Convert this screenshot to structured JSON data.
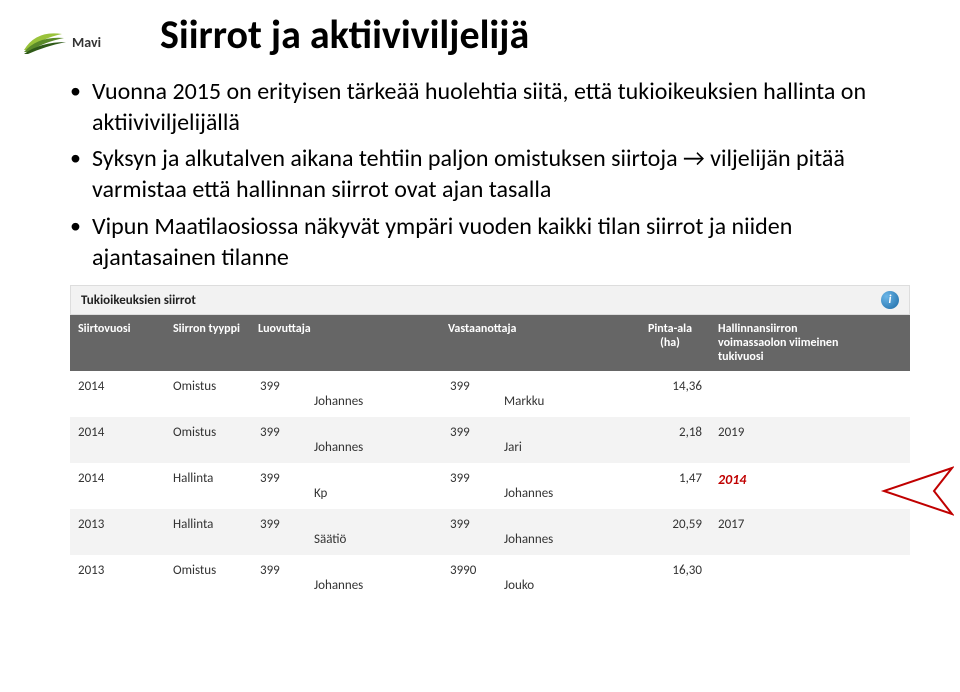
{
  "logo": {
    "text": "Mavi"
  },
  "title": "Siirrot ja aktiiviviljelijä",
  "bullets": [
    "Vuonna 2015 on erityisen tärkeää huolehtia siitä, että tukioikeuksien hallinta on aktiiviviljelijällä",
    "Syksyn ja alkutalven aikana tehtiin paljon omistuksen siirtoja → viljelijän pitää varmistaa että hallinnan siirrot ovat ajan tasalla",
    "Vipun Maatilaosiossa näkyvät ympäri vuoden kaikki tilan siirrot ja niiden ajantasainen tilanne"
  ],
  "panelTitle": "Tukioikeuksien siirrot",
  "headers": {
    "c1": "Siirtovuosi",
    "c2": "Siirron tyyppi",
    "c3": "Luovuttaja",
    "c4": "Vastaanottaja",
    "c5": "Pinta-ala (ha)",
    "c6": "Hallinnansiirron voimassaolon viimeinen tukivuosi"
  },
  "rows": [
    {
      "y": "2014",
      "t": "Omistus",
      "lnum": "399",
      "lname": "Johannes",
      "rnum": "399",
      "rname": "Markku",
      "area": "14,36",
      "end": ""
    },
    {
      "y": "2014",
      "t": "Omistus",
      "lnum": "399",
      "lname": "Johannes",
      "rnum": "399",
      "rname": "Jari",
      "area": "2,18",
      "end": "2019"
    },
    {
      "y": "2014",
      "t": "Hallinta",
      "lnum": "399",
      "lname": "Kp",
      "rnum": "399",
      "rname": "Johannes",
      "area": "1,47",
      "end": "2014",
      "red": true
    },
    {
      "y": "2013",
      "t": "Hallinta",
      "lnum": "399",
      "lname": "Säätiö",
      "rnum": "399",
      "rname": "Johannes",
      "area": "20,59",
      "end": "2017"
    },
    {
      "y": "2013",
      "t": "Omistus",
      "lnum": "399",
      "lname": "Johannes",
      "rnum": "3990",
      "rname": "Jouko",
      "area": "16,30",
      "end": ""
    }
  ]
}
